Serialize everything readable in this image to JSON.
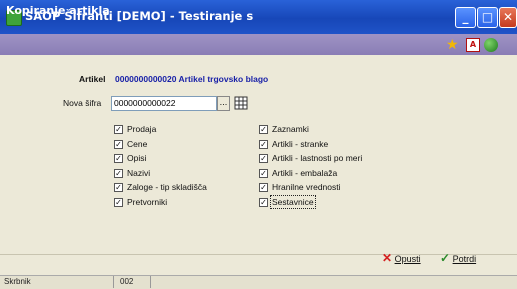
{
  "window": {
    "title": "SAOP Šifranti [DEMO] - Testiranje s",
    "minimize": "_",
    "maximize": "□",
    "close": "✕"
  },
  "dialog": {
    "title": "Kopiranje artikla"
  },
  "toolbar_icons": [
    "star-icon",
    "pdf-icon",
    "globe-icon"
  ],
  "article": {
    "label": "Artikel",
    "value": "0000000000020 Artikel trgovsko blago"
  },
  "new_code": {
    "label": "Nova šifra",
    "value": "0000000000022",
    "browse": "..."
  },
  "options_left": [
    {
      "label": "Prodaja",
      "checked": true
    },
    {
      "label": "Cene",
      "checked": true
    },
    {
      "label": "Opisi",
      "checked": true
    },
    {
      "label": "Nazivi",
      "checked": true
    },
    {
      "label": "Zaloge - tip skladišča",
      "checked": true
    },
    {
      "label": "Pretvorniki",
      "checked": true
    }
  ],
  "options_right": [
    {
      "label": "Zaznamki",
      "checked": true
    },
    {
      "label": "Artikli - stranke",
      "checked": true
    },
    {
      "label": "Artikli - lastnosti po meri",
      "checked": true
    },
    {
      "label": "Artikli - embalaža",
      "checked": true
    },
    {
      "label": "Hranilne vrednosti",
      "checked": true
    },
    {
      "label": "Sestavnice",
      "checked": true
    }
  ],
  "buttons": {
    "cancel": "Opusti",
    "confirm": "Potrdi"
  },
  "status": {
    "user": "Skrbnik",
    "code": "002"
  },
  "colors": {
    "title_bar": "#1f53c8",
    "dialog_bar": "#8a7db5",
    "article_value": "#1a22a8",
    "cancel_icon": "#d42020",
    "confirm_icon": "#2a8a2a"
  }
}
